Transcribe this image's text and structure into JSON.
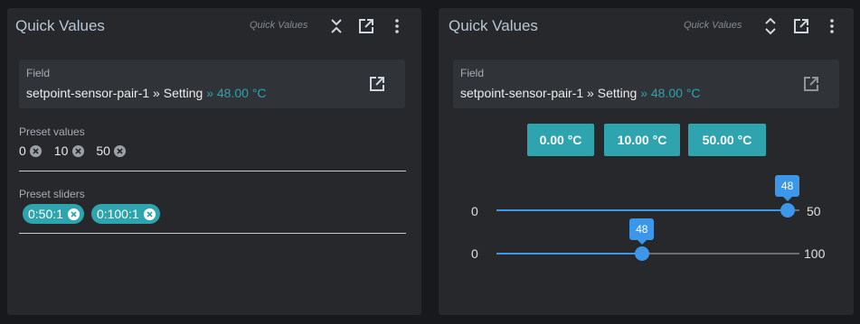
{
  "colors": {
    "background": "#17191d",
    "panel": "#26282c",
    "accent": "#2da4ae",
    "slider": "#3d97e8",
    "title": "#b8c7d6"
  },
  "left_panel": {
    "title": "Quick Values",
    "subtitle": "Quick Values",
    "collapse_icon": "collapse-vertical-icon",
    "field": {
      "label": "Field",
      "path": "setpoint-sensor-pair-1 » Setting",
      "extra": " » 48.00 °C"
    },
    "preset_values": {
      "label": "Preset values",
      "items": [
        "0",
        "10",
        "50"
      ]
    },
    "preset_sliders": {
      "label": "Preset sliders",
      "items": [
        "0:50:1",
        "0:100:1"
      ]
    }
  },
  "right_panel": {
    "title": "Quick Values",
    "subtitle": "Quick Values",
    "expand_icon": "expand-vertical-icon",
    "field": {
      "label": "Field",
      "path": "setpoint-sensor-pair-1 » Setting",
      "extra": " » 48.00 °C"
    },
    "preset_buttons": [
      "0.00 °C",
      "10.00 °C",
      "50.00 °C"
    ],
    "sliders": [
      {
        "min": "0",
        "max": "50",
        "value": "48",
        "min_value": 0,
        "max_value": 50,
        "current": 48
      },
      {
        "min": "0",
        "max": "100",
        "value": "48",
        "min_value": 0,
        "max_value": 100,
        "current": 48
      }
    ]
  }
}
